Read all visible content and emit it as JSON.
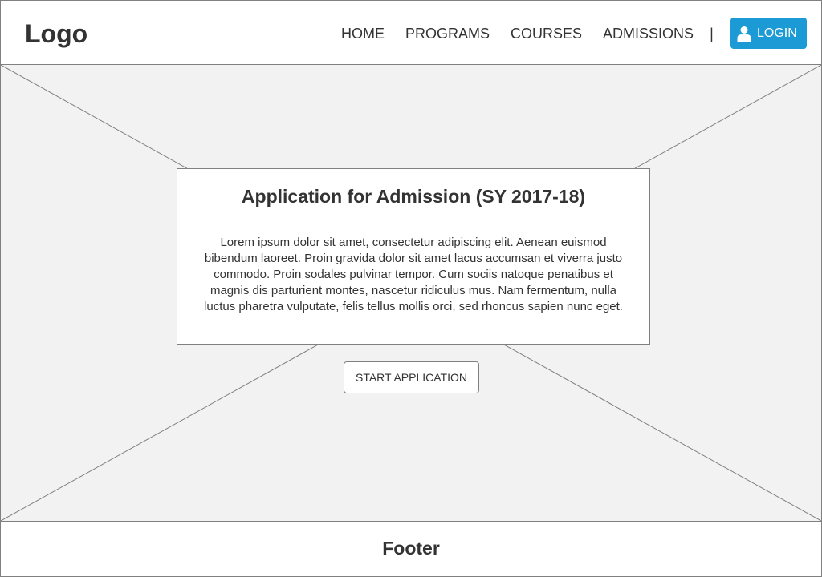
{
  "header": {
    "logo": "Logo",
    "nav": {
      "items": [
        {
          "label": "HOME"
        },
        {
          "label": "PROGRAMS"
        },
        {
          "label": "COURSES"
        },
        {
          "label": "ADMISSIONS"
        }
      ],
      "separator": "|"
    },
    "login": {
      "icon": "user-icon",
      "label": "LOGIN"
    }
  },
  "hero": {
    "title": "Application for Admission (SY 2017-18)",
    "body": "Lorem ipsum dolor sit amet, consectetur adipiscing elit. Aenean euismod bibendum laoreet. Proin gravida dolor sit amet lacus accumsan et viverra justo commodo. Proin sodales pulvinar tempor. Cum sociis natoque penatibus et magnis dis parturient montes, nascetur ridiculus mus. Nam fermentum, nulla luctus pharetra vulputate, felis tellus mollis orci, sed rhoncus sapien nunc eget.",
    "cta_label": "START APPLICATION"
  },
  "footer": {
    "label": "Footer"
  },
  "colors": {
    "accent": "#1c9ad6",
    "text": "#333333",
    "placeholder_bg": "#f2f2f2",
    "border": "#808080"
  }
}
